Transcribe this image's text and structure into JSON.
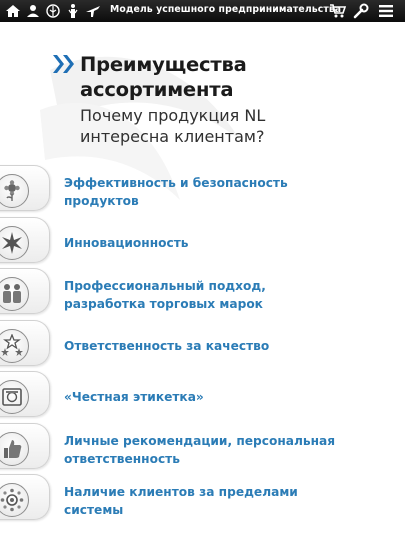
{
  "topbar": {
    "title": "Модель успешного предпринимательства",
    "left_icons": [
      "home-icon",
      "user-icon",
      "tree-icon",
      "people-icon",
      "airplane-icon"
    ],
    "right_icons": [
      "cart-icon",
      "tools-icon",
      "menu-icon"
    ]
  },
  "header": {
    "title_line1": "Преимущества",
    "title_line2": "ассортимента",
    "subtitle_line1": "Почему продукция NL",
    "subtitle_line2": "интересна клиентам?"
  },
  "items": [
    {
      "icon": "flower-icon",
      "line1": "Эффективность и безопасность",
      "line2": "продуктов"
    },
    {
      "icon": "star-burst-icon",
      "line1": "Инновационность",
      "line2": ""
    },
    {
      "icon": "handshake-team-icon",
      "line1": "Профессиональный подход,",
      "line2": "разработка торговых марок"
    },
    {
      "icon": "stars-icon",
      "line1": "Ответственность за качество",
      "line2": ""
    },
    {
      "icon": "label-icon",
      "line1": "«Честная этикетка»",
      "line2": ""
    },
    {
      "icon": "thumbs-up-icon",
      "line1": "Личные рекомендации, персональная",
      "line2": "ответственность"
    },
    {
      "icon": "globe-people-icon",
      "line1": "Наличие клиентов за пределами",
      "line2": "системы"
    }
  ],
  "colors": {
    "accent": "#2b7cb6",
    "chevron": "#1f6fb5",
    "topbar": "#111111"
  }
}
